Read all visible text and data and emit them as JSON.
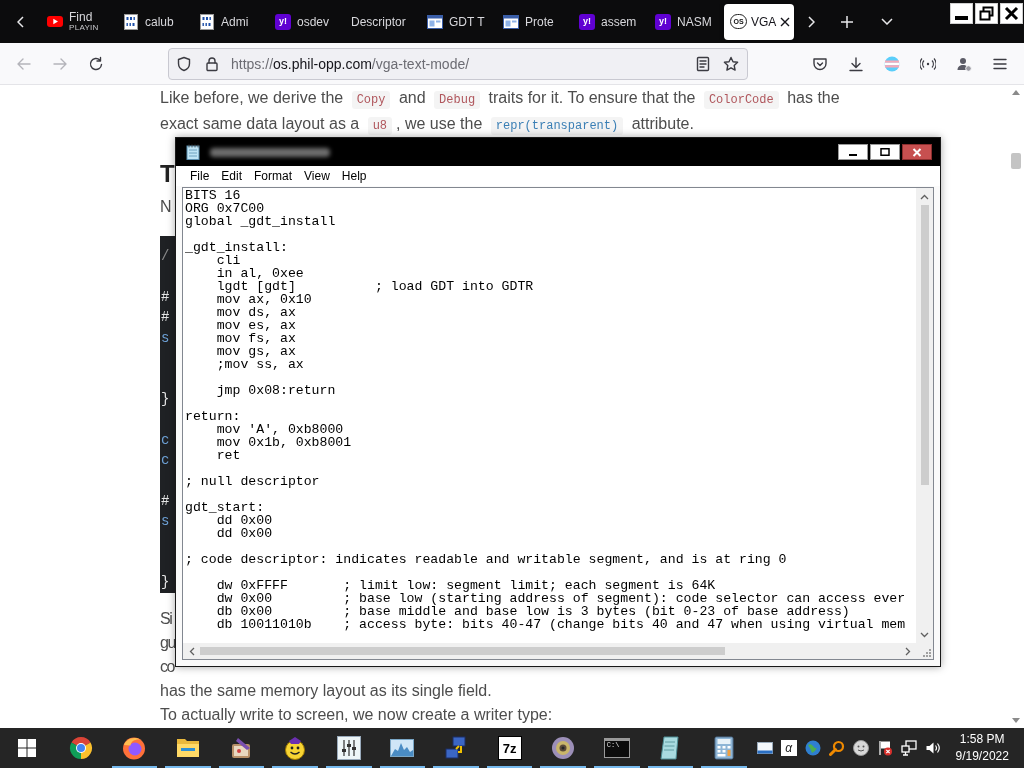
{
  "browser": {
    "tabs": [
      {
        "title": "Find",
        "subtitle": "PLAYIN",
        "favicon": {
          "kind": "play"
        },
        "selected": false
      },
      {
        "title": "calub",
        "favicon": {
          "kind": "binary"
        },
        "selected": false
      },
      {
        "title": "Admi",
        "favicon": {
          "kind": "binary"
        },
        "selected": false
      },
      {
        "title": "osdev",
        "favicon": {
          "kind": "tile",
          "text": "y!"
        },
        "selected": false
      },
      {
        "title": "Descriptor",
        "selected": false
      },
      {
        "title": "GDT T",
        "favicon": {
          "kind": "window"
        },
        "selected": false
      },
      {
        "title": "Prote",
        "favicon": {
          "kind": "window"
        },
        "selected": false
      },
      {
        "title": "assem",
        "favicon": {
          "kind": "tile",
          "text": "y!"
        },
        "selected": false
      },
      {
        "title": "NASM",
        "favicon": {
          "kind": "tile",
          "text": "y!"
        },
        "selected": false
      },
      {
        "title": "VGA",
        "favicon": {
          "kind": "ring",
          "text": "OS"
        },
        "selected": true
      }
    ],
    "address": {
      "scheme": "https://",
      "host": "os.phil-opp.com",
      "path": "/vga-text-mode/"
    }
  },
  "page": {
    "intro": [
      {
        "kind": "text",
        "text": "Like before, we derive the "
      },
      {
        "kind": "code",
        "text": "Copy"
      },
      {
        "kind": "text",
        "text": " and "
      },
      {
        "kind": "code",
        "text": "Debug"
      },
      {
        "kind": "text",
        "text": " traits for it. To ensure that the "
      },
      {
        "kind": "code",
        "text": "ColorCode"
      },
      {
        "kind": "text",
        "text": " has the exact same data layout as a "
      },
      {
        "kind": "code",
        "text": "u8"
      },
      {
        "kind": "text",
        "text": ", we use the "
      },
      {
        "kind": "link",
        "text": "repr(transparent)"
      },
      {
        "kind": "text",
        "text": " attribute."
      }
    ],
    "heading": "T",
    "lead": "N",
    "code_block": {
      "lines": [
        {
          "kind": "comment",
          "text": "/"
        },
        {
          "kind": "blank"
        },
        {
          "kind": "attribute",
          "text": "#"
        },
        {
          "kind": "attribute",
          "text": "#"
        },
        {
          "kind": "keyword",
          "text": "s"
        },
        {
          "kind": "blank"
        },
        {
          "kind": "blank"
        },
        {
          "kind": "punctuation",
          "text": "}"
        },
        {
          "kind": "blank"
        },
        {
          "kind": "keyword",
          "text": "c"
        },
        {
          "kind": "keyword",
          "text": "c"
        },
        {
          "kind": "blank"
        },
        {
          "kind": "attribute",
          "text": "#"
        },
        {
          "kind": "keyword",
          "text": "s"
        },
        {
          "kind": "blank"
        },
        {
          "kind": "blank"
        },
        {
          "kind": "punctuation",
          "text": "}"
        }
      ]
    },
    "fragments": [
      "Si",
      "gu",
      "co"
    ],
    "closing": "has the same memory layout as its single field.",
    "next": "To actually write to screen, we now create a writer type:"
  },
  "notepad": {
    "menu": [
      "File",
      "Edit",
      "Format",
      "View",
      "Help"
    ],
    "text": "BITS 16\nORG 0x7C00\nglobal _gdt_install\n\n_gdt_install:\n    cli\n    in al, 0xee\n    lgdt [gdt]          ; load GDT into GDTR\n    mov ax, 0x10\n    mov ds, ax\n    mov es, ax\n    mov fs, ax\n    mov gs, ax\n    ;mov ss, ax\n\n    jmp 0x08:return\n\nreturn:\n    mov 'A', 0xb8000\n    mov 0x1b, 0xb8001\n    ret\n\n; null descriptor\n\ngdt_start:\n    dd 0x00\n    dd 0x00\n\n; code descriptor: indicates readable and writable segment, and is at ring 0\n\n    dw 0xFFFF       ; limit low: segment limit; each segment is 64K\n    dw 0x00         ; base low (starting address of segment): code selector can access ever\n    db 0x00         ; base middle and base low is 3 bytes (bit 0-23 of base address)\n    db 10011010b    ; access byte: bits 40-47 (change bits 40 and 47 when using virtual mem"
  },
  "taskbar": {
    "apps": [
      {
        "kind": "chrome",
        "running": false
      },
      {
        "kind": "firefox",
        "running": true
      },
      {
        "kind": "folder",
        "running": true
      },
      {
        "kind": "paint",
        "running": true
      },
      {
        "kind": "messenger",
        "running": true
      },
      {
        "kind": "mixer",
        "running": true
      },
      {
        "kind": "chart",
        "running": true
      },
      {
        "kind": "network",
        "running": true
      },
      {
        "kind": "archive",
        "label": "7z",
        "running": true
      },
      {
        "kind": "disc",
        "running": true
      },
      {
        "kind": "console",
        "label": "C:\\",
        "running": true
      },
      {
        "kind": "notepad",
        "running": true
      },
      {
        "kind": "calculator",
        "running": true
      }
    ],
    "tray": [
      {
        "kind": "monitor"
      },
      {
        "kind": "letter",
        "label": "α"
      },
      {
        "kind": "globe"
      },
      {
        "kind": "magnifier"
      },
      {
        "kind": "smiley"
      },
      {
        "kind": "flag"
      },
      {
        "kind": "network"
      },
      {
        "kind": "speaker"
      }
    ],
    "time": "1:58 PM",
    "date": "9/19/2022"
  }
}
